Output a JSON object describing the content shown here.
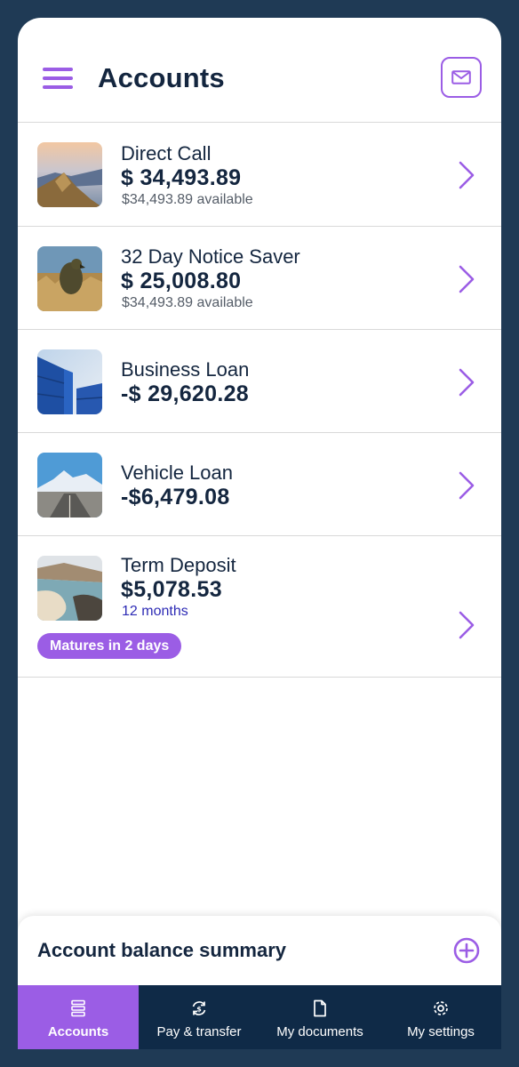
{
  "header": {
    "title": "Accounts",
    "menu_icon": "hamburger-menu-icon",
    "mail_icon": "envelope-icon"
  },
  "accounts": [
    {
      "name": "Direct Call",
      "balance": "$ 34,493.89",
      "sub": "$34,493.89 available",
      "image": "mountain-ridge-sunrise"
    },
    {
      "name": "32 Day Notice Saver",
      "balance": "$ 25,008.80",
      "sub": "$34,493.89 available",
      "image": "kea-bird-grass"
    },
    {
      "name": "Business Loan",
      "balance": "-$ 29,620.28",
      "sub": "",
      "image": "shipping-containers"
    },
    {
      "name": "Vehicle Loan",
      "balance": "-$6,479.08",
      "sub": "",
      "image": "road-to-mountain"
    },
    {
      "name": "Term Deposit",
      "balance": "$5,078.53",
      "sub": "12 months",
      "badge": "Matures in 2 days",
      "image": "coastal-beach"
    }
  ],
  "summary": {
    "title": "Account balance summary",
    "add_icon": "plus-circle-icon"
  },
  "tabs": [
    {
      "label": "Accounts",
      "icon": "list-stack-icon",
      "active": true
    },
    {
      "label": "Pay & transfer",
      "icon": "transfer-refresh-icon",
      "active": false
    },
    {
      "label": "My documents",
      "icon": "document-icon",
      "active": false
    },
    {
      "label": "My settings",
      "icon": "gear-icon",
      "active": false
    }
  ],
  "colors": {
    "accent": "#9b5de5",
    "navy": "#14263f",
    "tabbar": "#0f2a47",
    "frame": "#1f3a55"
  }
}
